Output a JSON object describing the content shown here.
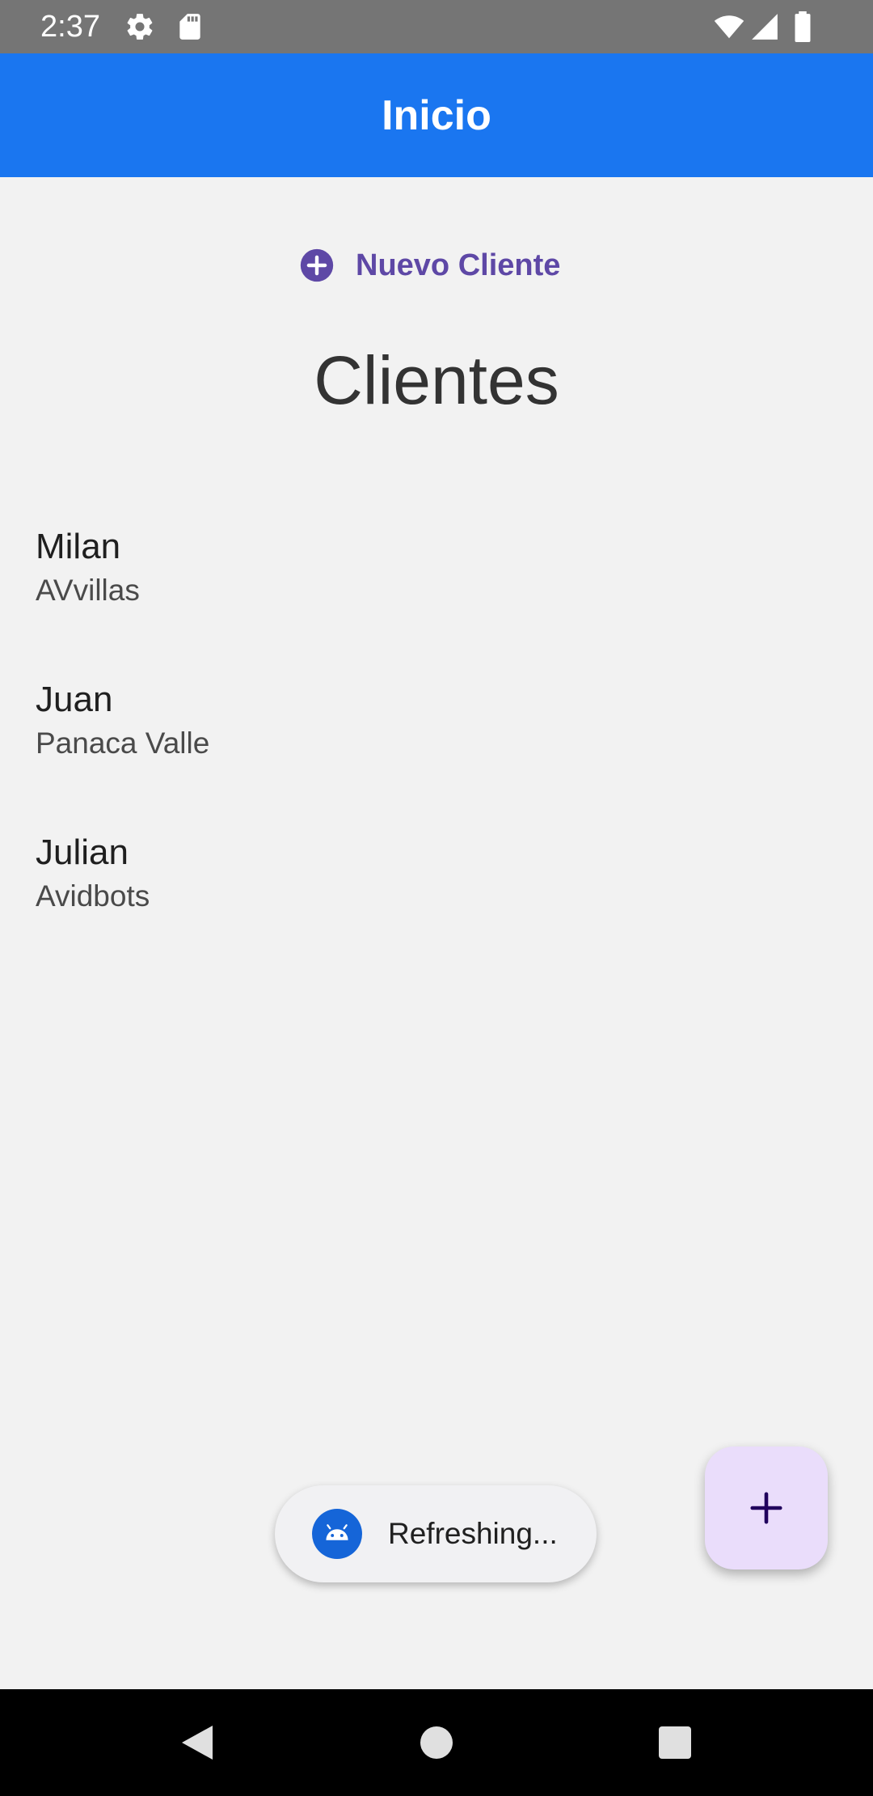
{
  "status_bar": {
    "time": "2:37",
    "icons": [
      "gear-icon",
      "sd-card-icon",
      "wifi-icon",
      "signal-icon",
      "battery-icon"
    ]
  },
  "app_bar": {
    "title": "Inicio",
    "color": "#1a76f0"
  },
  "new_client_button": {
    "label": "Nuevo Cliente",
    "icon": "add-circle-icon",
    "color": "#5e48a6"
  },
  "heading": "Clientes",
  "clients": [
    {
      "name": "Milan",
      "company": "AVvillas"
    },
    {
      "name": "Juan",
      "company": "Panaca Valle"
    },
    {
      "name": "Julian",
      "company": "Avidbots"
    }
  ],
  "toast": {
    "text": "Refreshing...",
    "icon": "android-icon"
  },
  "fab": {
    "icon": "plus-icon",
    "color": "#eaddfb"
  },
  "nav_bar": {
    "buttons": [
      "back-icon",
      "home-icon",
      "recents-icon"
    ]
  }
}
